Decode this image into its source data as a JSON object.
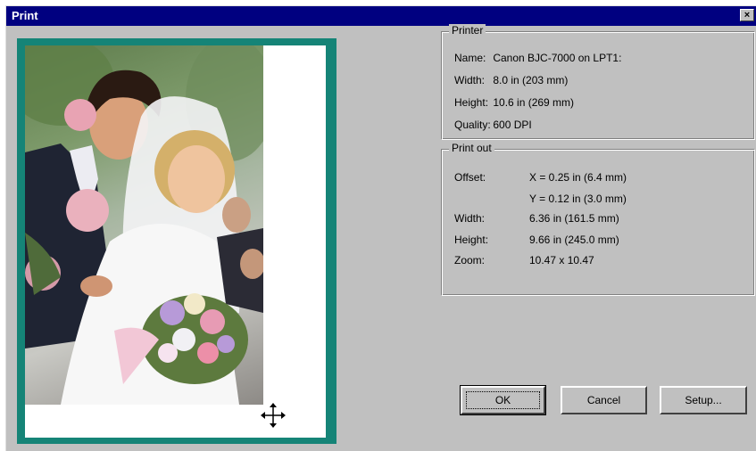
{
  "window": {
    "title": "Print",
    "close_label": "×"
  },
  "printer": {
    "legend": "Printer",
    "name_label": "Name:",
    "name_value": "Canon BJC-7000 on LPT1:",
    "width_label": "Width:",
    "width_value": "8.0 in (203 mm)",
    "height_label": "Height:",
    "height_value": "10.6 in (269 mm)",
    "quality_label": "Quality:",
    "quality_value": "600 DPI"
  },
  "printout": {
    "legend": "Print out",
    "offset_label": "Offset:",
    "offset_x": "X = 0.25 in (6.4 mm)",
    "offset_y": "Y = 0.12 in (3.0 mm)",
    "width_label": "Width:",
    "width_value": "6.36 in (161.5 mm)",
    "height_label": "Height:",
    "height_value": "9.66 in (245.0 mm)",
    "zoom_label": "Zoom:",
    "zoom_value": "10.47 x 10.47"
  },
  "buttons": {
    "ok": "OK",
    "cancel": "Cancel",
    "setup": "Setup..."
  },
  "icons": {
    "close": "close-icon",
    "move": "move-cursor-icon"
  },
  "colors": {
    "title_bar": "#000080",
    "preview_frame": "#158477",
    "dialog": "#c0c0c0"
  }
}
